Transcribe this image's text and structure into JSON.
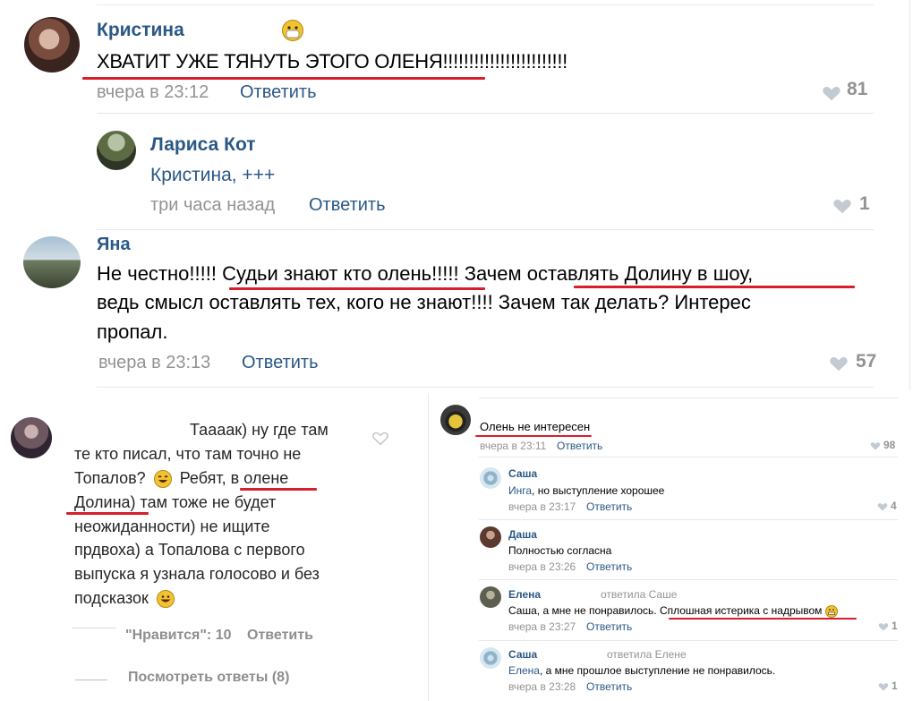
{
  "top": {
    "kristina": {
      "name": "Кристина",
      "text": "ХВАТИТ УЖЕ ТЯНУТЬ ЭТОГО ОЛЕНЯ!!!!!!!!!!!!!!!!!!!!!!!!",
      "time": "вчера в 23:12",
      "reply": "Ответить",
      "likes": "81"
    },
    "larisa": {
      "name": "Лариса Кот",
      "text": "Кристина, +++",
      "time": "три часа назад",
      "reply": "Ответить",
      "likes": "1"
    },
    "yana": {
      "name": "Яна",
      "line1": "Не честно!!!!! Судьи знают кто олень!!!!! Зачем оставлять Долину в шоу,",
      "line2": "ведь смысл оставлять тех, кого не знают!!!! Зачем так делать? Интерес",
      "line3": "пропал.",
      "time": "вчера в 23:13",
      "reply": "Ответить",
      "likes": "57"
    }
  },
  "left": {
    "l1": "Таааак) ну где там",
    "l2": "те кто писал, что там точно не",
    "l3": "Топалов?",
    "l3b": "Ребят,",
    "l3c": "в олене",
    "l4": "Долина)",
    "l4b": "там тоже не будет",
    "l5": "неожиданности) не ищите",
    "l6": "прдвоха) а Топалова с первого",
    "l7": "выпуска я узнала голосово и без",
    "l8": "подсказок",
    "likes_label": "\"Нравится\": 10",
    "reply": "Ответить",
    "view_replies": "Посмотреть ответы (8)"
  },
  "right": {
    "main": {
      "text": "Олень не интересен",
      "time": "вчера в 23:11",
      "reply": "Ответить",
      "likes": "98"
    },
    "sasha1": {
      "name": "Саша",
      "name_in_text": "Инга",
      "text": ", но выступление хорошее",
      "time": "вчера в 23:17",
      "reply": "Ответить",
      "likes": "4"
    },
    "dasha": {
      "name": "Даша",
      "text": "Полностью согласна",
      "time": "вчера в 23:26",
      "reply": "Ответить"
    },
    "elena": {
      "name": "Елена",
      "replied_to": "ответила Саше",
      "text1": "Саша, а мне не понравилось.",
      "text2": "Сплошная истерика с надрывом",
      "time": "вчера в 23:27",
      "reply": "Ответить",
      "likes": "1"
    },
    "sasha2": {
      "name": "Саша",
      "replied_to": "ответила Елене",
      "name_in_text": "Елена",
      "text": ", а мне прошлое выступление не понравилось.",
      "time": "вчера в 23:28",
      "reply": "Ответить",
      "likes": "1"
    }
  }
}
